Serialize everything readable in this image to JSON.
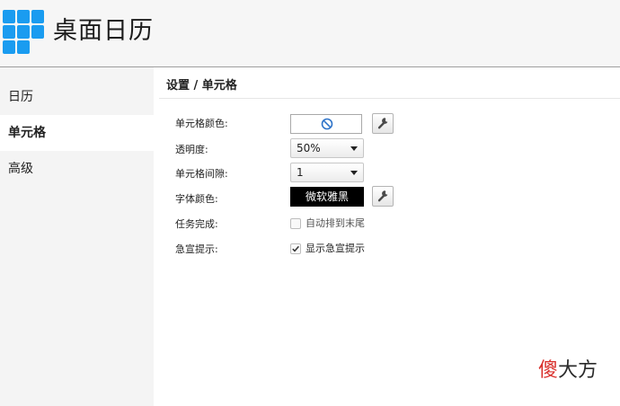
{
  "app": {
    "title": "桌面日历"
  },
  "sidebar": {
    "items": [
      {
        "label": "日历",
        "active": false
      },
      {
        "label": "单元格",
        "active": true
      },
      {
        "label": "高级",
        "active": false
      }
    ]
  },
  "main": {
    "breadcrumb": "设置 / 单元格",
    "cell_color": {
      "label": "单元格颜色:",
      "value": "none",
      "icon": "no-color-icon"
    },
    "opacity": {
      "label": "透明度:",
      "value": "50%"
    },
    "cell_spacing": {
      "label": "单元格间隙:",
      "value": "1"
    },
    "font_color": {
      "label": "字体颜色:",
      "sample_text": "微软雅黑",
      "sample_bg": "#000000",
      "sample_fg": "#ffffff"
    },
    "task_done": {
      "label": "任务完成:",
      "checkbox_label": "自动排到末尾",
      "checked": false
    },
    "urgent_hint": {
      "label": "急宣提示:",
      "checkbox_label": "显示急宣提示",
      "checked": true
    }
  },
  "watermark": {
    "part1": "傻",
    "part2": "大方"
  },
  "colors": {
    "accent": "#1a9cf0",
    "no_color_icon": "#2f74c9",
    "watermark_red": "#d9302c"
  },
  "icons": {
    "logo": "grid-logo-icon",
    "settings_tool": "wrench-icon",
    "dropdown": "caret-down-icon",
    "check": "checkmark-icon"
  }
}
